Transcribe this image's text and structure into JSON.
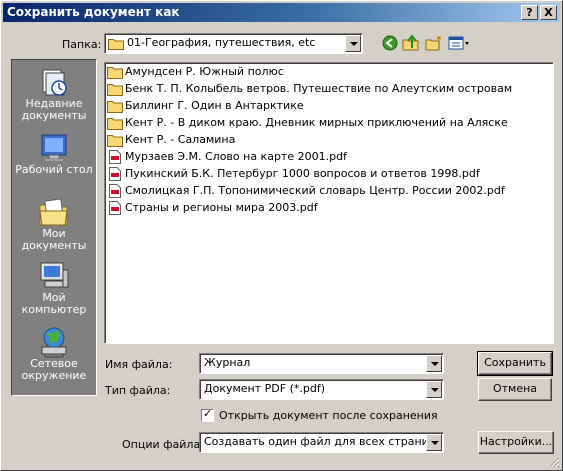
{
  "window": {
    "title": "Сохранить документ как"
  },
  "titlebar": {
    "help_label": "?",
    "close_label": "X"
  },
  "folder": {
    "label": "Папка:",
    "value": "01-География, путешествия, etc"
  },
  "toolbar": {
    "back_icon": "back-arrow-icon",
    "up_icon": "up-folder-icon",
    "new_folder_icon": "new-folder-icon",
    "view_icon": "view-menu-icon"
  },
  "places": [
    {
      "label": "Недавние документы",
      "line1": "Недавние",
      "line2": "документы",
      "icon": "recent-documents-icon"
    },
    {
      "label": "Рабочий стол",
      "line1": "Рабочий стол",
      "line2": "",
      "icon": "desktop-icon"
    },
    {
      "label": "Мои документы",
      "line1": "Мои",
      "line2": "документы",
      "icon": "my-documents-icon"
    },
    {
      "label": "Мой компьютер",
      "line1": "Мой",
      "line2": "компьютер",
      "icon": "my-computer-icon"
    },
    {
      "label": "Сетевое окружение",
      "line1": "Сетевое",
      "line2": "окружение",
      "icon": "network-icon"
    }
  ],
  "files": [
    {
      "name": "Амундсен Р. Южный полюс",
      "type": "folder"
    },
    {
      "name": "Бенк Т. П. Колыбель ветров. Путешествие по Алеутским островам",
      "type": "folder"
    },
    {
      "name": "Биллинг Г. Один в Антарктике",
      "type": "folder"
    },
    {
      "name": "Кент Р. - В диком краю. Дневник мирных приключений на Аляске",
      "type": "folder"
    },
    {
      "name": "Кент Р. - Саламина",
      "type": "folder"
    },
    {
      "name": "Мурзаев Э.М. Слово на карте 2001.pdf",
      "type": "pdf"
    },
    {
      "name": "Пукинский Б.К. Петербург 1000 вопросов и ответов 1998.pdf",
      "type": "pdf"
    },
    {
      "name": "Смолицкая Г.П. Топонимический словарь Центр. России 2002.pdf",
      "type": "pdf"
    },
    {
      "name": "Страны и регионы мира 2003.pdf",
      "type": "pdf"
    }
  ],
  "filename": {
    "label": "Имя файла:",
    "value": "Журнал"
  },
  "filetype": {
    "label": "Тип файла:",
    "value": "Документ PDF (*.pdf)"
  },
  "buttons": {
    "save": "Сохранить",
    "cancel": "Отмена",
    "settings": "Настройки..."
  },
  "open_after_save": {
    "label": "Открыть документ после сохранения",
    "checked": true,
    "mark": "✓"
  },
  "file_options": {
    "label": "Опции файла:",
    "value": "Создавать один файл для всех страниц"
  },
  "colors": {
    "title_start": "#0a246a",
    "title_end": "#a6caf0",
    "places_bg": "#808080",
    "dialog_bg": "#d4d0c8"
  }
}
